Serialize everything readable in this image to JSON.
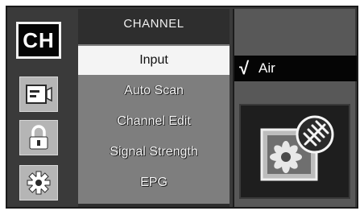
{
  "sidebar": {
    "ch_label": "CH",
    "icons": [
      "picture-icon",
      "lock-icon",
      "gear-icon"
    ]
  },
  "menu": {
    "title": "CHANNEL",
    "items": [
      {
        "label": "Input",
        "selected": true
      },
      {
        "label": "Auto Scan",
        "selected": false
      },
      {
        "label": "Channel Edit",
        "selected": false
      },
      {
        "label": "Signal Strength",
        "selected": false
      },
      {
        "label": "EPG",
        "selected": false
      }
    ]
  },
  "submenu": {
    "check_mark": "√",
    "selected_value": "Air"
  },
  "preview": {
    "icon": "antenna-picture-icon"
  },
  "colors": {
    "screen_bg": "#3a3a3a",
    "menu_bg": "#7e7e7e",
    "selected_bg": "#f4f4f4",
    "highlight_row": "#050505"
  }
}
